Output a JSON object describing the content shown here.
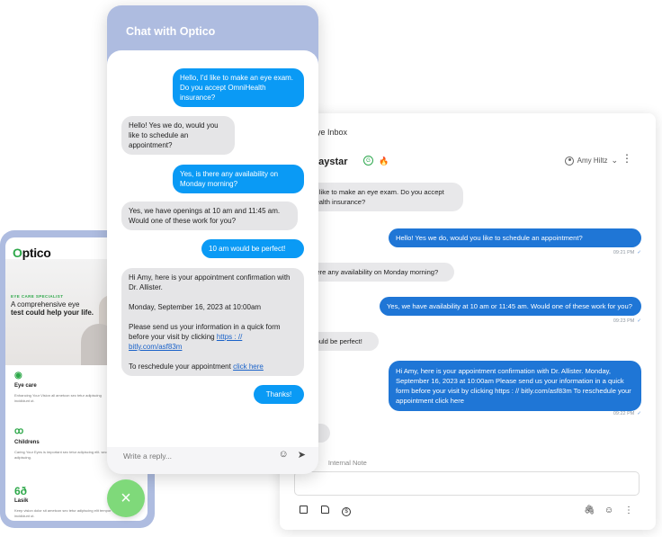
{
  "inbox": {
    "title": "irdeye Inbox",
    "contact_name": "y Daystar",
    "assignee": "Amy Hiltz",
    "messages": [
      {
        "dir": "in",
        "text": "I'd like to make an eye exam. Do you accept Health insurance?"
      },
      {
        "dir": "out",
        "text": "Hello! Yes we do, would you like to schedule an appointment?",
        "time": "09:21 PM"
      },
      {
        "dir": "in",
        "text": "there any availability on Monday morning?"
      },
      {
        "dir": "out",
        "text": "Yes, we have availability at 10 am or 11:45 am. Would one of these work for you?",
        "time": "09:23 PM"
      },
      {
        "dir": "in",
        "text": "would be perfect!"
      },
      {
        "dir": "out",
        "text": "Hi Amy, here is your appointment confirmation with Dr. Allister.     Monday, September 16, 2023 at 10:00am     Please send us your information in a quick form before your visit by clicking https : // bitly.com/asf83m   To reschedule your appointment click here",
        "time": "09:22 PM"
      },
      {
        "dir": "in",
        "text": "s!"
      }
    ],
    "tab_text": "xt",
    "tab_internal_note": "Internal Note",
    "check_mark": "✓"
  },
  "site": {
    "logo_rest": "ptico",
    "logo_o": "O",
    "eyebrow": "EYE CARE SPECIALIST",
    "headline_1": "A comprehensive eye",
    "headline_2": "test could help your life.",
    "features": [
      {
        "icon": "eye-icon",
        "title": "Eye care",
        "text": "Enhancing Your Vision all ametcon sec tetur adipiscing incididunt ut."
      },
      {
        "icon": "glasses-icon",
        "title": "Childrens",
        "text": "Caring Your Eyes is important sec tetur adipiscing elit. sec tetur adipiscing."
      },
      {
        "icon": "lasik-icon",
        "title": "Lasik",
        "text": "Keep vision dolor sit ametcon sec tetur adipiscing elit tempor incididunt ut."
      }
    ]
  },
  "chat": {
    "title": "Chat with Optico",
    "messages": [
      {
        "dir": "out",
        "text": "Hello, I'd like to make an eye exam. Do you accept OmniHealth insurance?"
      },
      {
        "dir": "in",
        "text": "Hello! Yes we do, would you like to schedule an appointment?"
      },
      {
        "dir": "out",
        "text": "Yes, is there any availability on Monday morning?"
      },
      {
        "dir": "in",
        "text": "Yes, we have openings at 10 am and 11:45 am. Would one of these work for you?"
      },
      {
        "dir": "out",
        "text": "10 am would be perfect!"
      },
      {
        "dir": "in",
        "p1": "Hi Amy, here is your appointment confirmation with Dr. Allister.",
        "p2": "Monday, September 16, 2023 at 10:00am",
        "p3": "Please send us your information in a quick form before your visit by clicking ",
        "link1": "https : // bitly.com/asf83m",
        "p4": "To reschedule your appointment ",
        "link2": "click here"
      },
      {
        "dir": "out",
        "text": "Thanks!"
      }
    ],
    "reply_placeholder": "Write a reply..."
  },
  "fab": {
    "label": "×"
  },
  "colors": {
    "chat_header": "#aebce0",
    "chat_out": "#0a9af5",
    "inbox_out": "#1f76d6",
    "accent_green": "#2ea84a",
    "fab": "#7fd97a"
  }
}
